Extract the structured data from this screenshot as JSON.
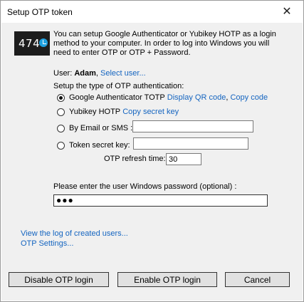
{
  "window": {
    "title": "Setup OTP token",
    "close_glyph": "✕"
  },
  "logo": {
    "text": "474",
    "icon": "check-circle-icon",
    "accent": "#1fa1e0"
  },
  "intro": "You can setup Google Authenticator or Yubikey HOTP as a login method to your computer. In order to log into Windows you will need to enter OTP or OTP + Password.",
  "user": {
    "label": "User:",
    "name": "Adam",
    "separator": ",",
    "select_link": "Select user..."
  },
  "setup_type_label": "Setup the type of OTP authentication:",
  "options": {
    "google": {
      "label": "Google Authenticator TOTP",
      "link1": "Display QR code",
      "sep": ",",
      "link2": "Copy code",
      "selected": true
    },
    "yubikey": {
      "label": "Yubikey HOTP",
      "link": "Copy secret key",
      "selected": false
    },
    "email": {
      "label": "By Email or SMS :",
      "value": "",
      "selected": false
    },
    "token": {
      "label": "Token secret key:",
      "value": "",
      "selected": false
    }
  },
  "refresh": {
    "label": "OTP refresh time:",
    "value": "30"
  },
  "password": {
    "label": "Please enter the user Windows password (optional) :",
    "masked": "●●●"
  },
  "bottom_links": {
    "log": "View the log of created users...",
    "settings": "OTP Settings..."
  },
  "buttons": {
    "disable": "Disable OTP login",
    "enable": "Enable OTP login",
    "cancel": "Cancel"
  },
  "colors": {
    "link": "#1565c0",
    "panel": "#f0f0f0"
  }
}
